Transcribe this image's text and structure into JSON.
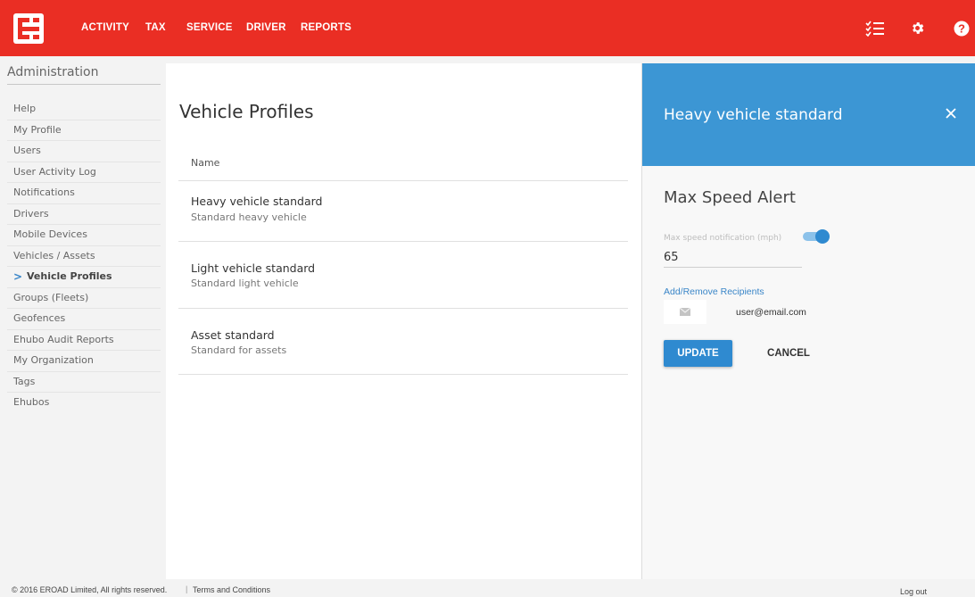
{
  "header": {
    "nav": [
      "ACTIVITY",
      "TAX",
      "SERVICE",
      "DRIVER",
      "REPORTS"
    ],
    "brand_color": "#ea2e24",
    "icons": [
      "checklist-icon",
      "gear-icon",
      "help-icon"
    ]
  },
  "sidebar": {
    "title": "Administration",
    "items": [
      {
        "label": "Help"
      },
      {
        "label": "My Profile"
      },
      {
        "label": "Users"
      },
      {
        "label": "User Activity Log"
      },
      {
        "label": "Notifications"
      },
      {
        "label": "Drivers"
      },
      {
        "label": "Mobile Devices"
      },
      {
        "label": "Vehicles / Assets"
      },
      {
        "label": "Vehicle Profiles",
        "active": true
      },
      {
        "label": "Groups (Fleets)"
      },
      {
        "label": "Geofences"
      },
      {
        "label": "Ehubo Audit Reports"
      },
      {
        "label": "My Organization"
      },
      {
        "label": "Tags"
      },
      {
        "label": "Ehubos"
      }
    ],
    "active_marker": ">"
  },
  "main": {
    "title": "Vehicle Profiles",
    "column_header": "Name",
    "rows": [
      {
        "name": "Heavy vehicle standard",
        "description": "Standard heavy vehicle"
      },
      {
        "name": "Light vehicle standard",
        "description": "Standard light vehicle"
      },
      {
        "name": "Asset standard",
        "description": "Standard for assets"
      }
    ]
  },
  "panel": {
    "title": "Heavy vehicle standard",
    "accent_color": "#3c96d4",
    "section_title": "Max Speed Alert",
    "field_label": "Max speed notification (mph)",
    "field_value": "65",
    "toggle_on": true,
    "recipients_link": "Add/Remove Recipients",
    "recipient_email": "user@email.com",
    "update_label": "UPDATE",
    "cancel_label": "CANCEL"
  },
  "footer": {
    "copyright": "© 2016 EROAD Limited, All rights reserved.",
    "separator": "|",
    "terms": "Terms and Conditions",
    "logout": "Log out"
  }
}
